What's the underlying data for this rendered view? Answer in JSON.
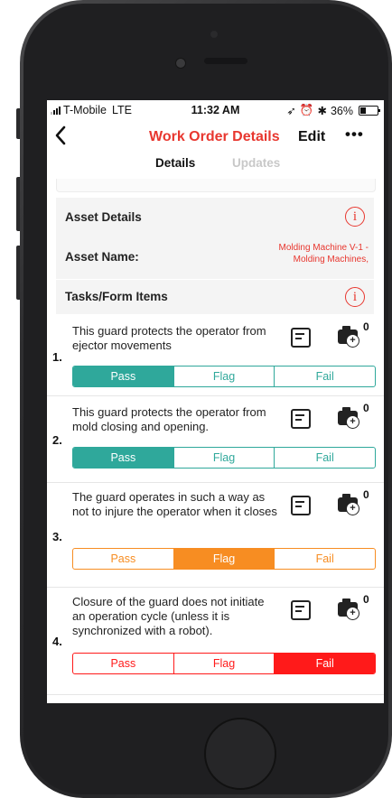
{
  "status_bar": {
    "carrier": "T-Mobile",
    "network": "LTE",
    "time": "11:32 AM",
    "battery": "36%"
  },
  "nav": {
    "back_icon": "chevron-left-icon",
    "title": "Work Order Details",
    "edit": "Edit",
    "more": "•••"
  },
  "tabs": [
    {
      "label": "Details",
      "active": true
    },
    {
      "label": "Updates",
      "active": false
    }
  ],
  "asset_details": {
    "heading": "Asset Details",
    "name_label": "Asset Name:",
    "name_value_line1": "Molding Machine V-1 -",
    "name_value_line2": "Molding Machines,"
  },
  "tasks_heading": "Tasks/Form Items",
  "tasks": [
    {
      "number": "1.",
      "text": "This guard protects the operator from ejector movements",
      "photo_count": "0",
      "options": [
        "Pass",
        "Flag",
        "Fail"
      ],
      "selected": "Pass"
    },
    {
      "number": "2.",
      "text": "This guard protects the operator from mold closing and opening.",
      "photo_count": "0",
      "options": [
        "Pass",
        "Flag",
        "Fail"
      ],
      "selected": "Pass"
    },
    {
      "number": "3.",
      "text": "The guard operates in such a way as not to injure the operator when it closes",
      "photo_count": "0",
      "options": [
        "Pass",
        "Flag",
        "Fail"
      ],
      "selected": "Flag"
    },
    {
      "number": "4.",
      "text": "Closure of the guard does not initiate an operation cycle (unless it is synchronized with a robot).",
      "photo_count": "0",
      "options": [
        "Pass",
        "Flag",
        "Fail"
      ],
      "selected": "Fail"
    }
  ],
  "colors": {
    "accent": "#e8372f",
    "pass": "#2fa89b",
    "flag": "#f78d22",
    "fail": "#ff1a1a"
  }
}
